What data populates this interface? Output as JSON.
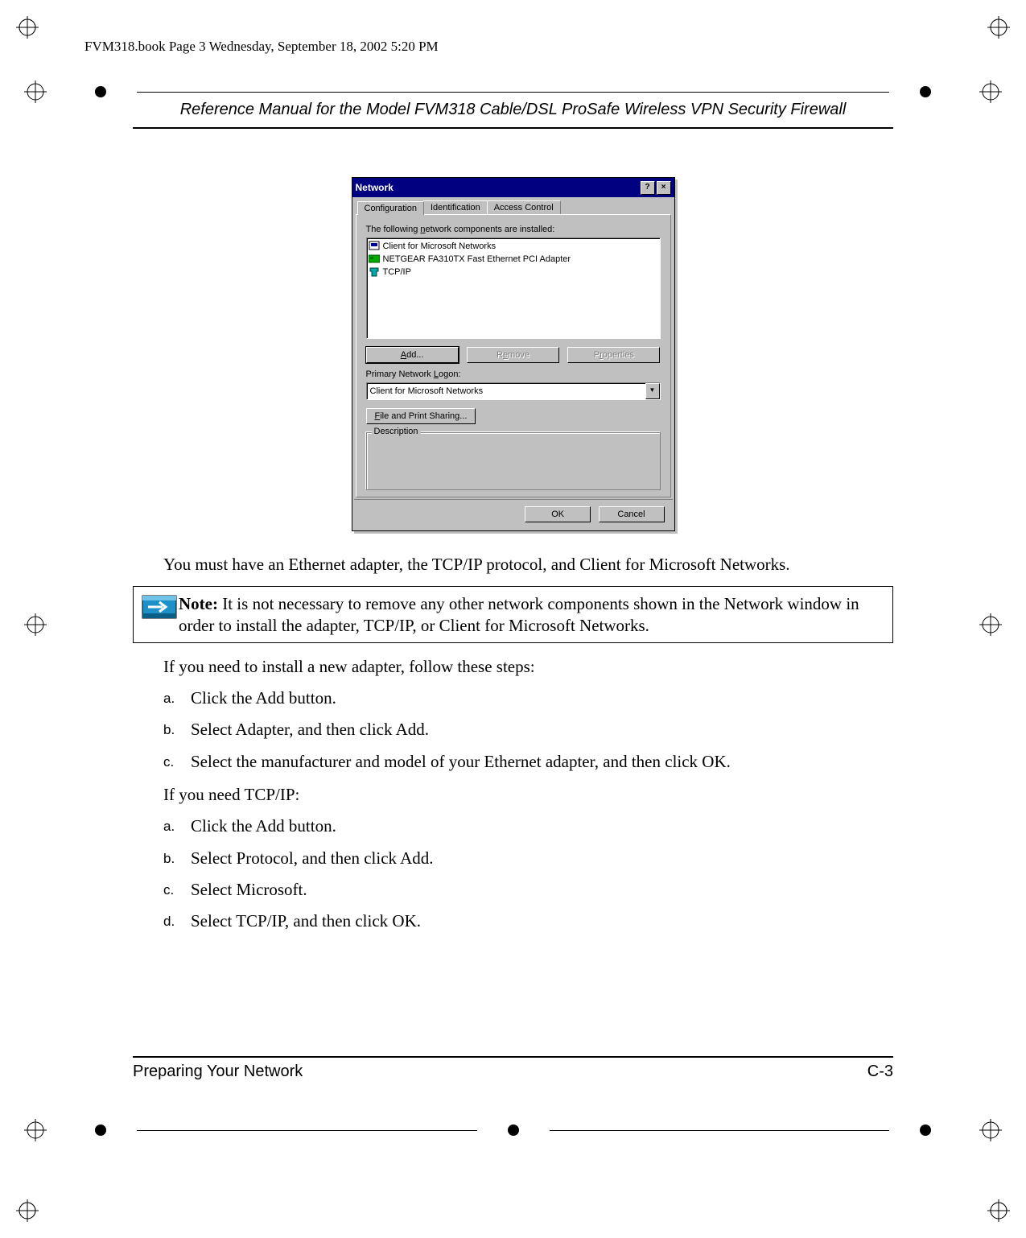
{
  "header_info": "FVM318.book  Page 3  Wednesday, September 18, 2002  5:20 PM",
  "running_head": "Reference Manual for the Model FVM318 Cable/DSL ProSafe Wireless VPN Security Firewall",
  "dialog": {
    "title": "Network",
    "help_btn": "?",
    "close_btn": "×",
    "tabs": {
      "configuration": "Configuration",
      "identification": "Identification",
      "access": "Access Control"
    },
    "list_label": "The following network components are installed:",
    "list_items": [
      "Client for Microsoft Networks",
      "NETGEAR FA310TX Fast Ethernet PCI Adapter",
      "TCP/IP"
    ],
    "buttons": {
      "add": "Add...",
      "remove": "Remove",
      "properties": "Properties"
    },
    "logon_label": "Primary Network Logon:",
    "logon_value": "Client for Microsoft Networks",
    "file_share": "File and Print Sharing...",
    "desc_legend": "Description",
    "ok": "OK",
    "cancel": "Cancel"
  },
  "para_after_figure": "You must have an Ethernet adapter, the TCP/IP protocol, and Client for Microsoft Networks.",
  "note_label": "Note:",
  "note_body": " It is not necessary to remove any other network components shown in the Network window in order to install the adapter, TCP/IP, or Client for Microsoft Networks.",
  "adapter_intro": "If you need to install a new adapter, follow these steps:",
  "adapter_steps": [
    "Click the Add button.",
    "Select Adapter, and then click Add.",
    "Select the manufacturer and model of your Ethernet adapter, and then click OK."
  ],
  "tcpip_intro": "If you need TCP/IP:",
  "tcpip_steps": [
    "Click the Add button.",
    "Select Protocol, and then click Add.",
    "Select Microsoft.",
    "Select TCP/IP, and then click OK."
  ],
  "footer": {
    "left": "Preparing Your Network",
    "right": "C-3"
  }
}
